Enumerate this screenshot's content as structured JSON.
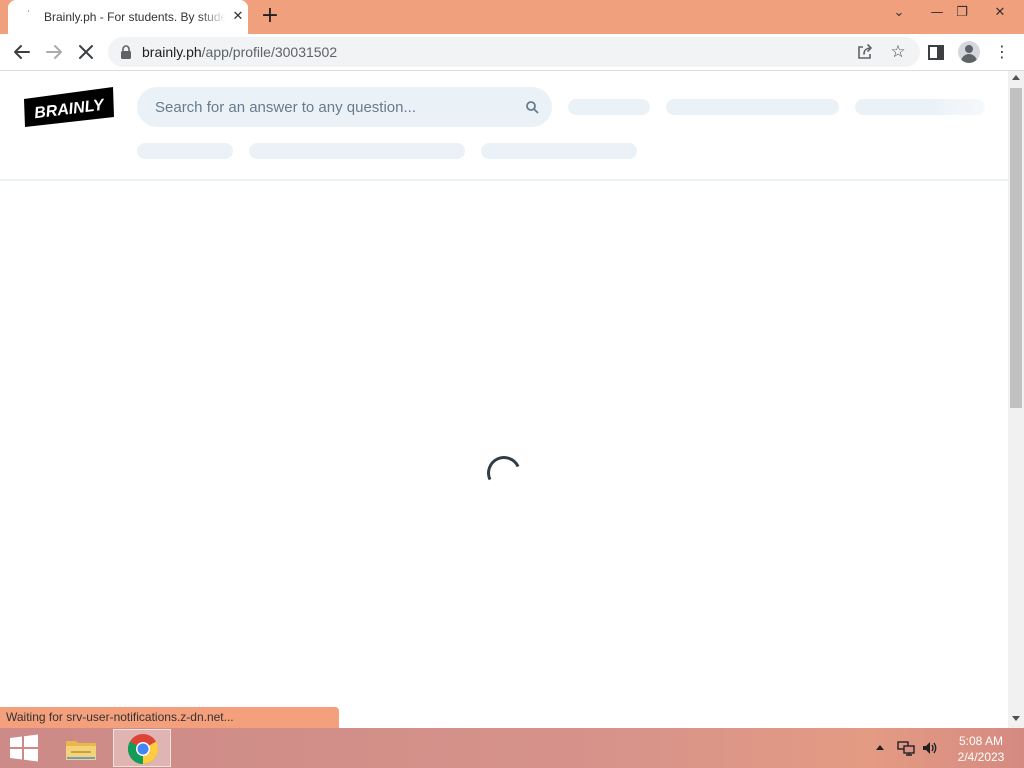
{
  "browser": {
    "tab": {
      "title": "Brainly.ph - For students. By students.",
      "close_glyph": "✕",
      "favicon_glyph": "˙"
    },
    "new_tab_glyph": "+",
    "window_controls": {
      "tab_search_glyph": "⌄",
      "minimize_glyph": "—",
      "maximize_glyph": "❐",
      "close_glyph": "✕"
    },
    "address_bar": {
      "domain": "brainly.ph",
      "path": "/app/profile/30031502"
    },
    "star_glyph": "☆",
    "menu_glyph": "⋮",
    "page_loading": true,
    "status_text": "Waiting for srv-user-notifications.z-dn.net..."
  },
  "page": {
    "logo_text": "BRAINLY",
    "search": {
      "placeholder": "Search for an answer to any question...",
      "value": ""
    },
    "loading": true
  },
  "taskbar": {
    "apps": [
      {
        "name": "File Explorer",
        "active": false
      },
      {
        "name": "Google Chrome",
        "active": true
      }
    ],
    "clock": {
      "time": "5:08 AM",
      "date": "2/4/2023"
    }
  },
  "colors": {
    "title_bar": "#f0a07c",
    "brand_black": "#000000",
    "search_bg": "#ebf2f7",
    "skeleton": "#ebf2f7",
    "status_bubble": "#f4a07c"
  }
}
